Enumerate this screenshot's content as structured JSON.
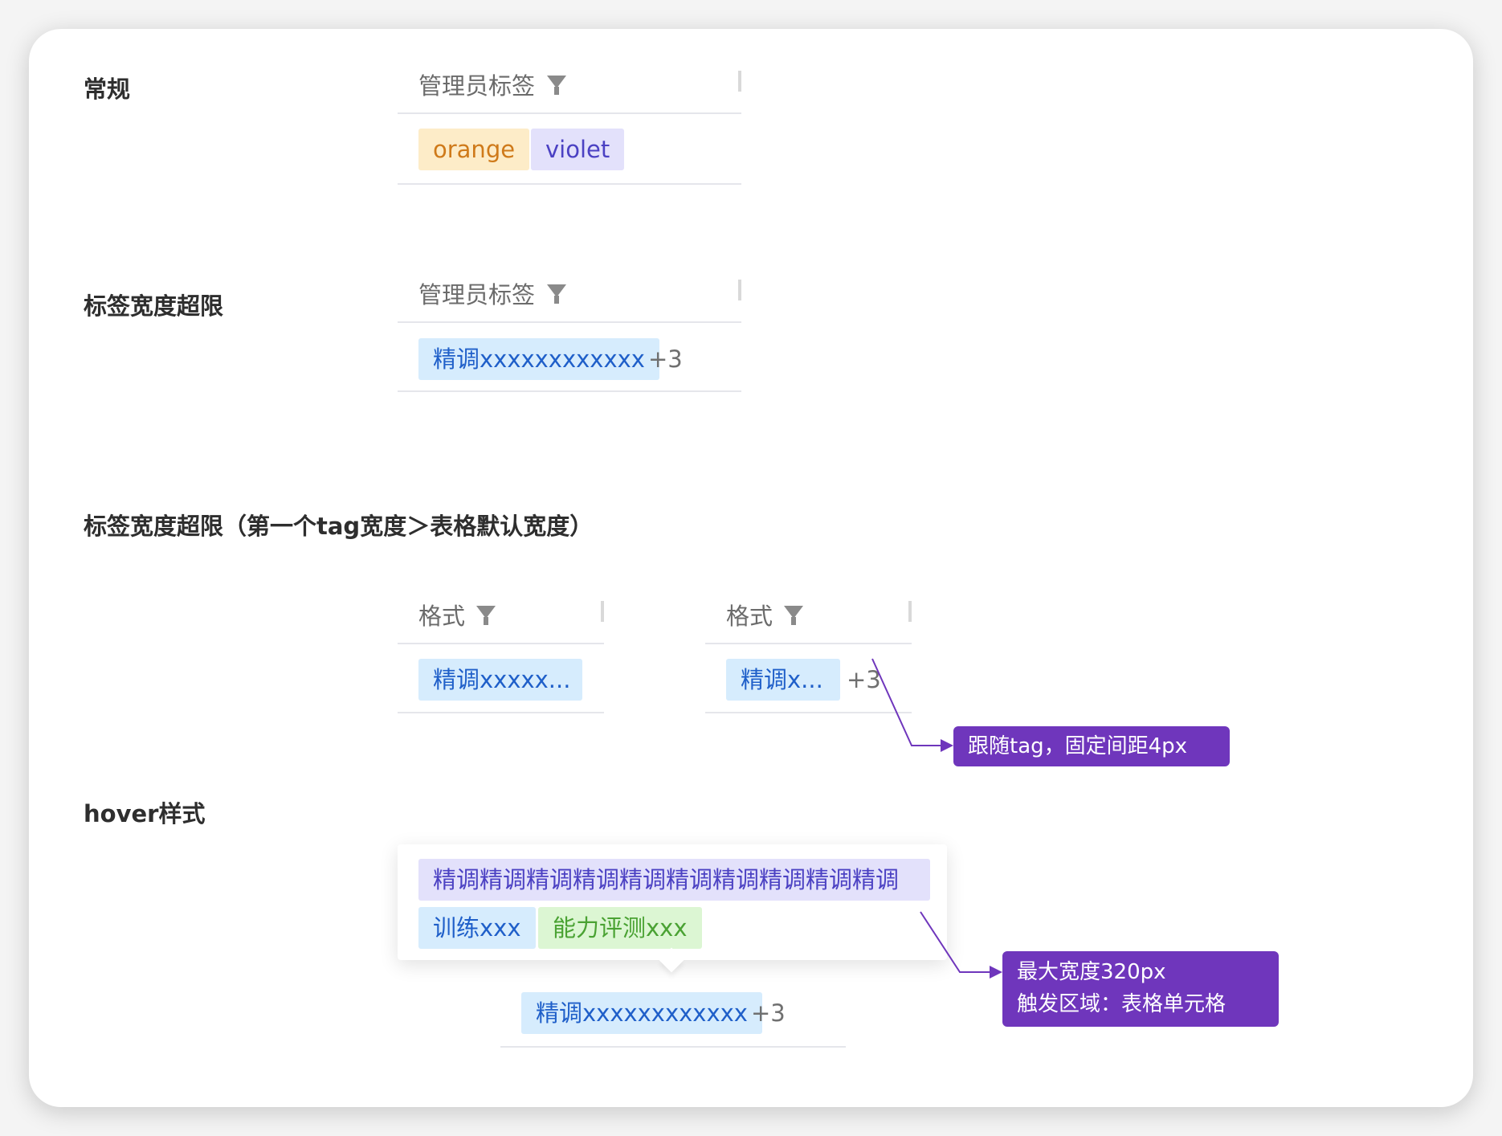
{
  "sections": {
    "normal": "常规",
    "overflow": "标签宽度超限",
    "overflow_first": "标签宽度超限（第一个tag宽度＞表格默认宽度）",
    "hover": "hover样式"
  },
  "column_headers": {
    "admin_tags": "管理员标签",
    "format": "格式"
  },
  "normal_tags": [
    "orange",
    "violet"
  ],
  "overflow_tag": "精调xxxxxxxxxxxx",
  "more_count": "+3",
  "truncated_tag_a": "精调xxxxx...",
  "truncated_tag_b": "精调x...",
  "hover_tags": {
    "long": "精调精调精调精调精调精调精调精调精调精调",
    "train": "训练xxx",
    "ability": "能力评测xxx"
  },
  "hover_cell_tag": "精调xxxxxxxxxxxx",
  "annotations": {
    "follow": "跟随tag，固定间距4px",
    "max_width": "最大宽度320px",
    "trigger": "触发区域：表格单元格"
  },
  "colors": {
    "callout_bg": "#6f36bc",
    "tag_orange_bg": "#fdecc8",
    "tag_violet_bg": "#e3e1fb",
    "tag_blue_bg": "#d6ecfd",
    "tag_green_bg": "#dcf6d3"
  },
  "icons": {
    "filter": "funnel-filter-icon"
  }
}
